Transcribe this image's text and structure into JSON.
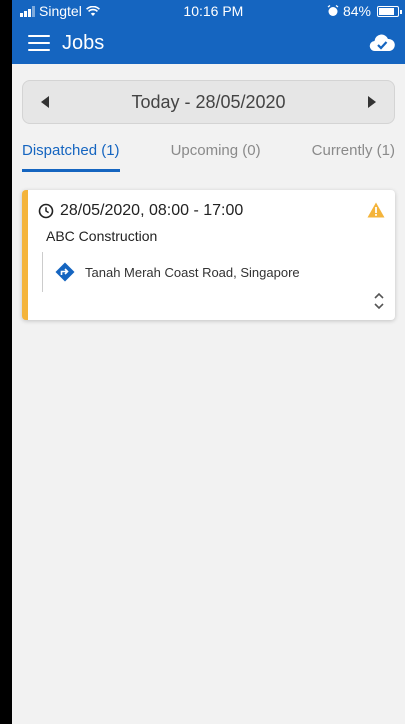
{
  "status_bar": {
    "carrier": "Singtel",
    "time": "10:16 PM",
    "battery": "84%"
  },
  "appbar": {
    "title": "Jobs",
    "menu_icon": "hamburger-icon",
    "cloud_icon": "cloud-check-icon"
  },
  "date_selector": {
    "label": "Today - 28/05/2020"
  },
  "tabs": [
    {
      "label": "Dispatched (1)",
      "active": true
    },
    {
      "label": "Upcoming (0)",
      "active": false
    },
    {
      "label": "Currently (1)",
      "active": false
    }
  ],
  "jobs": [
    {
      "time": "28/05/2020, 08:00 - 17:00",
      "company": "ABC Construction",
      "address": "Tanah Merah Coast Road, Singapore"
    }
  ],
  "colors": {
    "primary": "#1565c0",
    "accent": "#f4b43b",
    "background": "#f2f2f2"
  }
}
